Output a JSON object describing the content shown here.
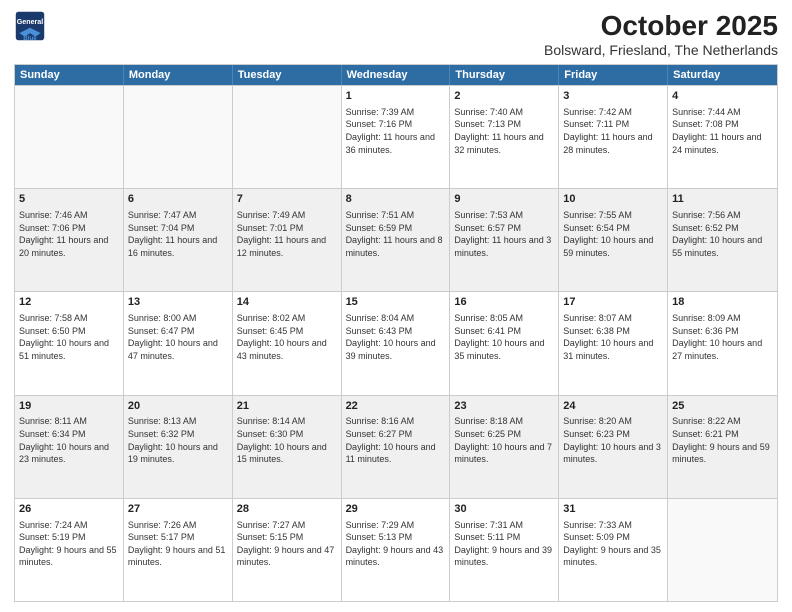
{
  "header": {
    "logo_line1": "General",
    "logo_line2": "Blue",
    "title": "October 2025",
    "subtitle": "Bolsward, Friesland, The Netherlands"
  },
  "days_of_week": [
    "Sunday",
    "Monday",
    "Tuesday",
    "Wednesday",
    "Thursday",
    "Friday",
    "Saturday"
  ],
  "weeks": [
    [
      {
        "day": "",
        "sunrise": "",
        "sunset": "",
        "daylight": ""
      },
      {
        "day": "",
        "sunrise": "",
        "sunset": "",
        "daylight": ""
      },
      {
        "day": "",
        "sunrise": "",
        "sunset": "",
        "daylight": ""
      },
      {
        "day": "1",
        "sunrise": "Sunrise: 7:39 AM",
        "sunset": "Sunset: 7:16 PM",
        "daylight": "Daylight: 11 hours and 36 minutes."
      },
      {
        "day": "2",
        "sunrise": "Sunrise: 7:40 AM",
        "sunset": "Sunset: 7:13 PM",
        "daylight": "Daylight: 11 hours and 32 minutes."
      },
      {
        "day": "3",
        "sunrise": "Sunrise: 7:42 AM",
        "sunset": "Sunset: 7:11 PM",
        "daylight": "Daylight: 11 hours and 28 minutes."
      },
      {
        "day": "4",
        "sunrise": "Sunrise: 7:44 AM",
        "sunset": "Sunset: 7:08 PM",
        "daylight": "Daylight: 11 hours and 24 minutes."
      }
    ],
    [
      {
        "day": "5",
        "sunrise": "Sunrise: 7:46 AM",
        "sunset": "Sunset: 7:06 PM",
        "daylight": "Daylight: 11 hours and 20 minutes."
      },
      {
        "day": "6",
        "sunrise": "Sunrise: 7:47 AM",
        "sunset": "Sunset: 7:04 PM",
        "daylight": "Daylight: 11 hours and 16 minutes."
      },
      {
        "day": "7",
        "sunrise": "Sunrise: 7:49 AM",
        "sunset": "Sunset: 7:01 PM",
        "daylight": "Daylight: 11 hours and 12 minutes."
      },
      {
        "day": "8",
        "sunrise": "Sunrise: 7:51 AM",
        "sunset": "Sunset: 6:59 PM",
        "daylight": "Daylight: 11 hours and 8 minutes."
      },
      {
        "day": "9",
        "sunrise": "Sunrise: 7:53 AM",
        "sunset": "Sunset: 6:57 PM",
        "daylight": "Daylight: 11 hours and 3 minutes."
      },
      {
        "day": "10",
        "sunrise": "Sunrise: 7:55 AM",
        "sunset": "Sunset: 6:54 PM",
        "daylight": "Daylight: 10 hours and 59 minutes."
      },
      {
        "day": "11",
        "sunrise": "Sunrise: 7:56 AM",
        "sunset": "Sunset: 6:52 PM",
        "daylight": "Daylight: 10 hours and 55 minutes."
      }
    ],
    [
      {
        "day": "12",
        "sunrise": "Sunrise: 7:58 AM",
        "sunset": "Sunset: 6:50 PM",
        "daylight": "Daylight: 10 hours and 51 minutes."
      },
      {
        "day": "13",
        "sunrise": "Sunrise: 8:00 AM",
        "sunset": "Sunset: 6:47 PM",
        "daylight": "Daylight: 10 hours and 47 minutes."
      },
      {
        "day": "14",
        "sunrise": "Sunrise: 8:02 AM",
        "sunset": "Sunset: 6:45 PM",
        "daylight": "Daylight: 10 hours and 43 minutes."
      },
      {
        "day": "15",
        "sunrise": "Sunrise: 8:04 AM",
        "sunset": "Sunset: 6:43 PM",
        "daylight": "Daylight: 10 hours and 39 minutes."
      },
      {
        "day": "16",
        "sunrise": "Sunrise: 8:05 AM",
        "sunset": "Sunset: 6:41 PM",
        "daylight": "Daylight: 10 hours and 35 minutes."
      },
      {
        "day": "17",
        "sunrise": "Sunrise: 8:07 AM",
        "sunset": "Sunset: 6:38 PM",
        "daylight": "Daylight: 10 hours and 31 minutes."
      },
      {
        "day": "18",
        "sunrise": "Sunrise: 8:09 AM",
        "sunset": "Sunset: 6:36 PM",
        "daylight": "Daylight: 10 hours and 27 minutes."
      }
    ],
    [
      {
        "day": "19",
        "sunrise": "Sunrise: 8:11 AM",
        "sunset": "Sunset: 6:34 PM",
        "daylight": "Daylight: 10 hours and 23 minutes."
      },
      {
        "day": "20",
        "sunrise": "Sunrise: 8:13 AM",
        "sunset": "Sunset: 6:32 PM",
        "daylight": "Daylight: 10 hours and 19 minutes."
      },
      {
        "day": "21",
        "sunrise": "Sunrise: 8:14 AM",
        "sunset": "Sunset: 6:30 PM",
        "daylight": "Daylight: 10 hours and 15 minutes."
      },
      {
        "day": "22",
        "sunrise": "Sunrise: 8:16 AM",
        "sunset": "Sunset: 6:27 PM",
        "daylight": "Daylight: 10 hours and 11 minutes."
      },
      {
        "day": "23",
        "sunrise": "Sunrise: 8:18 AM",
        "sunset": "Sunset: 6:25 PM",
        "daylight": "Daylight: 10 hours and 7 minutes."
      },
      {
        "day": "24",
        "sunrise": "Sunrise: 8:20 AM",
        "sunset": "Sunset: 6:23 PM",
        "daylight": "Daylight: 10 hours and 3 minutes."
      },
      {
        "day": "25",
        "sunrise": "Sunrise: 8:22 AM",
        "sunset": "Sunset: 6:21 PM",
        "daylight": "Daylight: 9 hours and 59 minutes."
      }
    ],
    [
      {
        "day": "26",
        "sunrise": "Sunrise: 7:24 AM",
        "sunset": "Sunset: 5:19 PM",
        "daylight": "Daylight: 9 hours and 55 minutes."
      },
      {
        "day": "27",
        "sunrise": "Sunrise: 7:26 AM",
        "sunset": "Sunset: 5:17 PM",
        "daylight": "Daylight: 9 hours and 51 minutes."
      },
      {
        "day": "28",
        "sunrise": "Sunrise: 7:27 AM",
        "sunset": "Sunset: 5:15 PM",
        "daylight": "Daylight: 9 hours and 47 minutes."
      },
      {
        "day": "29",
        "sunrise": "Sunrise: 7:29 AM",
        "sunset": "Sunset: 5:13 PM",
        "daylight": "Daylight: 9 hours and 43 minutes."
      },
      {
        "day": "30",
        "sunrise": "Sunrise: 7:31 AM",
        "sunset": "Sunset: 5:11 PM",
        "daylight": "Daylight: 9 hours and 39 minutes."
      },
      {
        "day": "31",
        "sunrise": "Sunrise: 7:33 AM",
        "sunset": "Sunset: 5:09 PM",
        "daylight": "Daylight: 9 hours and 35 minutes."
      },
      {
        "day": "",
        "sunrise": "",
        "sunset": "",
        "daylight": ""
      }
    ]
  ]
}
